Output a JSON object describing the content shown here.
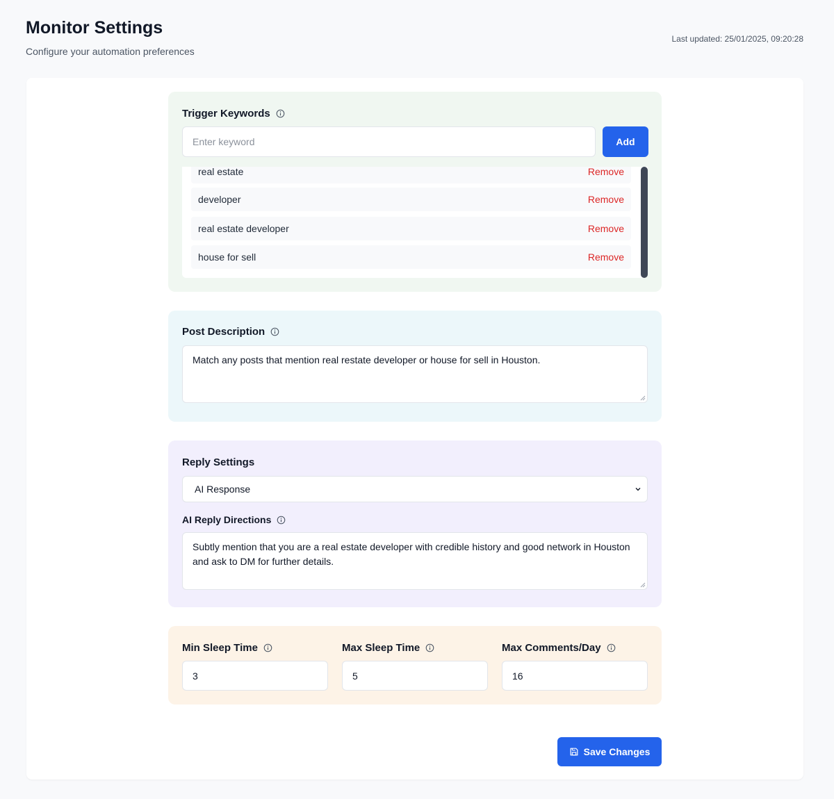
{
  "header": {
    "title": "Monitor Settings",
    "subtitle": "Configure your automation preferences",
    "last_updated": "Last updated: 25/01/2025, 09:20:28"
  },
  "keywords": {
    "label": "Trigger Keywords",
    "input_placeholder": "Enter keyword",
    "input_value": "",
    "add_label": "Add",
    "remove_label": "Remove",
    "items": [
      "real estate",
      "developer",
      "real estate developer",
      "house for sell"
    ]
  },
  "post_description": {
    "label": "Post Description",
    "value": "Match any posts that mention real restate developer or house for sell in Houston."
  },
  "reply": {
    "label": "Reply Settings",
    "selected": "AI Response",
    "directions_label": "AI Reply Directions",
    "directions_value": "Subtly mention that you are a real estate developer with credible history and good network in Houston and ask to DM for further details."
  },
  "limits": {
    "min_sleep_label": "Min Sleep Time",
    "min_sleep_value": "3",
    "max_sleep_label": "Max Sleep Time",
    "max_sleep_value": "5",
    "max_comments_label": "Max Comments/Day",
    "max_comments_value": "16"
  },
  "footer": {
    "save_label": "Save Changes"
  },
  "colors": {
    "accent": "#2463eb",
    "danger": "#dc2626",
    "keywords_bg": "#f0f7f1",
    "description_bg": "#ecf7fa",
    "reply_bg": "#f2effd",
    "limits_bg": "#fdf3e7"
  }
}
